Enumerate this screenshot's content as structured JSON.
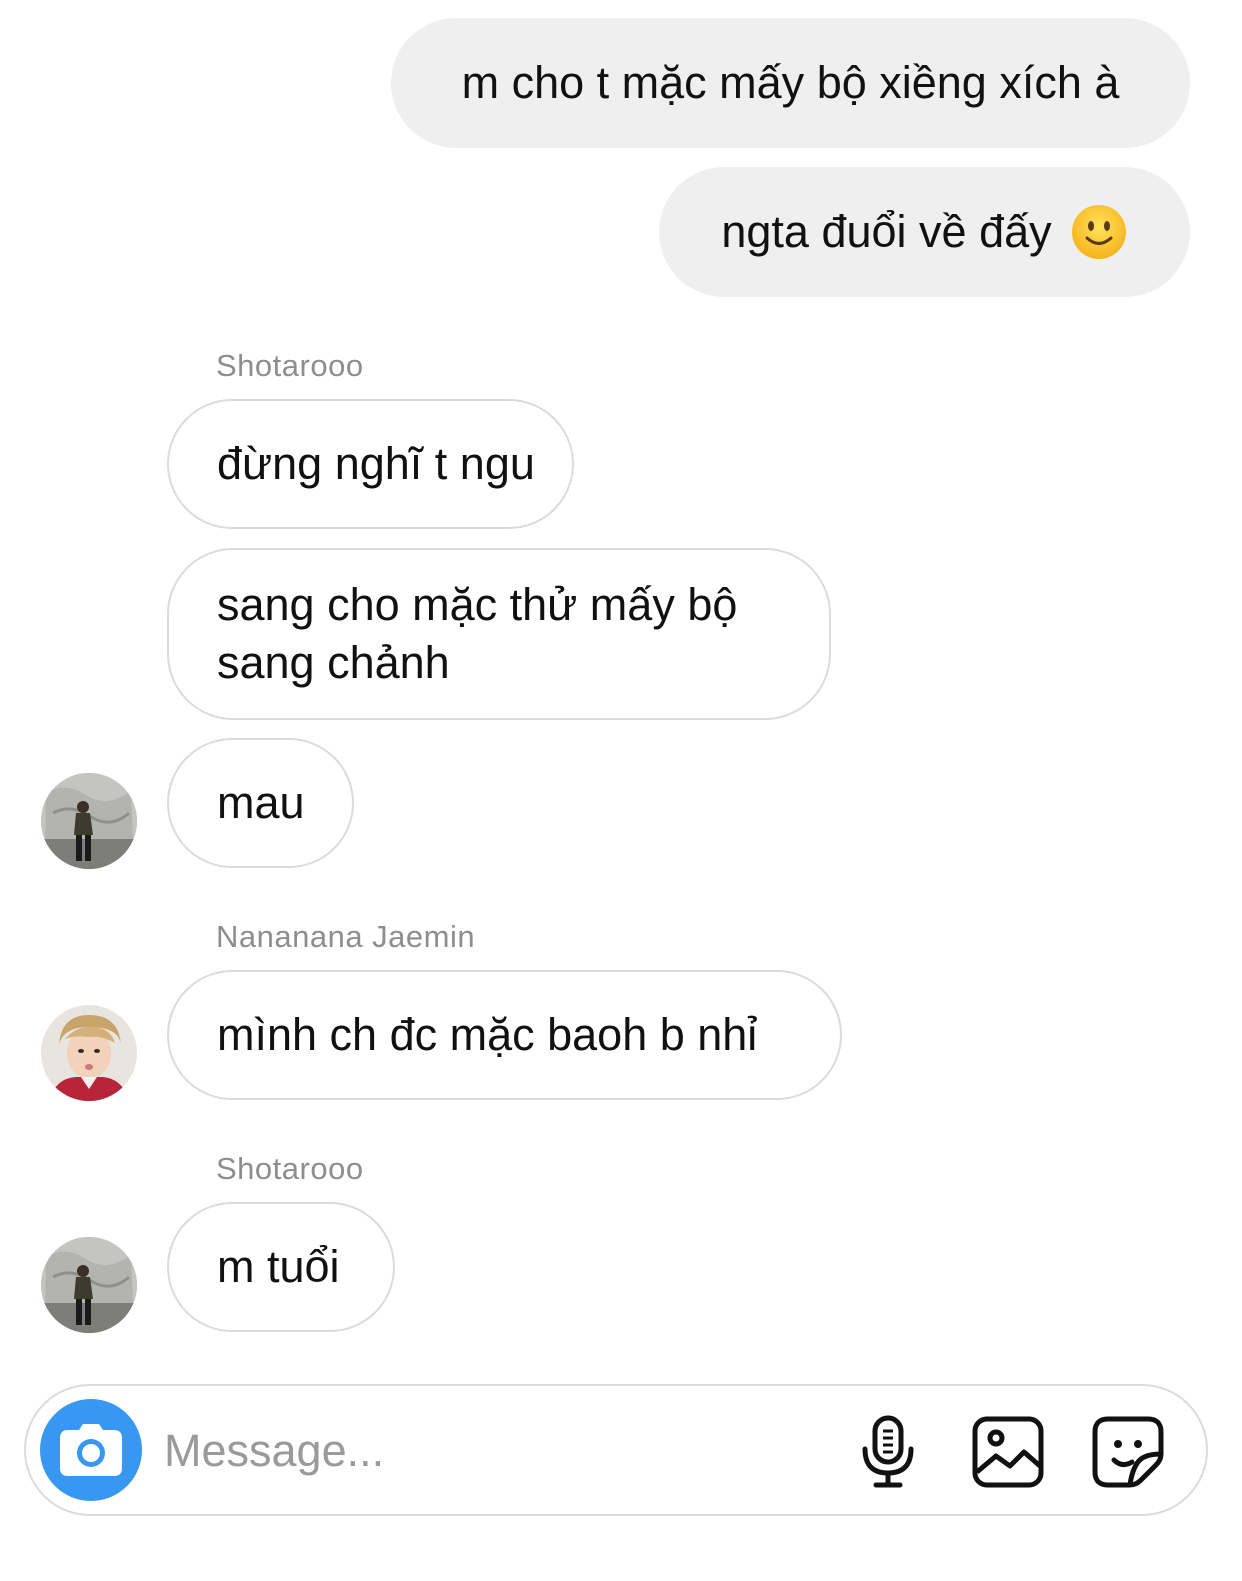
{
  "messages": {
    "out1": "m cho t mặc mấy bộ xiềng xích à",
    "out2": "ngta đuổi về đấy",
    "out2_emoji": "slightly-smiling-face",
    "sender1": "Shotarooo",
    "in1": "đừng nghĩ t ngu",
    "in2": "sang cho mặc thử mấy bộ sang chảnh",
    "in3": "mau",
    "sender2": "Nananana Jaemin",
    "in4": "mình ch đc mặc baoh b nhỉ",
    "sender3": "Shotarooo",
    "in5": "m tuổi"
  },
  "composer": {
    "placeholder": "Message...",
    "icons": [
      "camera-icon",
      "microphone-icon",
      "gallery-icon",
      "sticker-icon"
    ],
    "camera_color": "#3897f0"
  },
  "colors": {
    "outgoing_bubble": "#efefef",
    "incoming_border": "#dbdbdb",
    "sender_name": "#8e8e8e"
  }
}
